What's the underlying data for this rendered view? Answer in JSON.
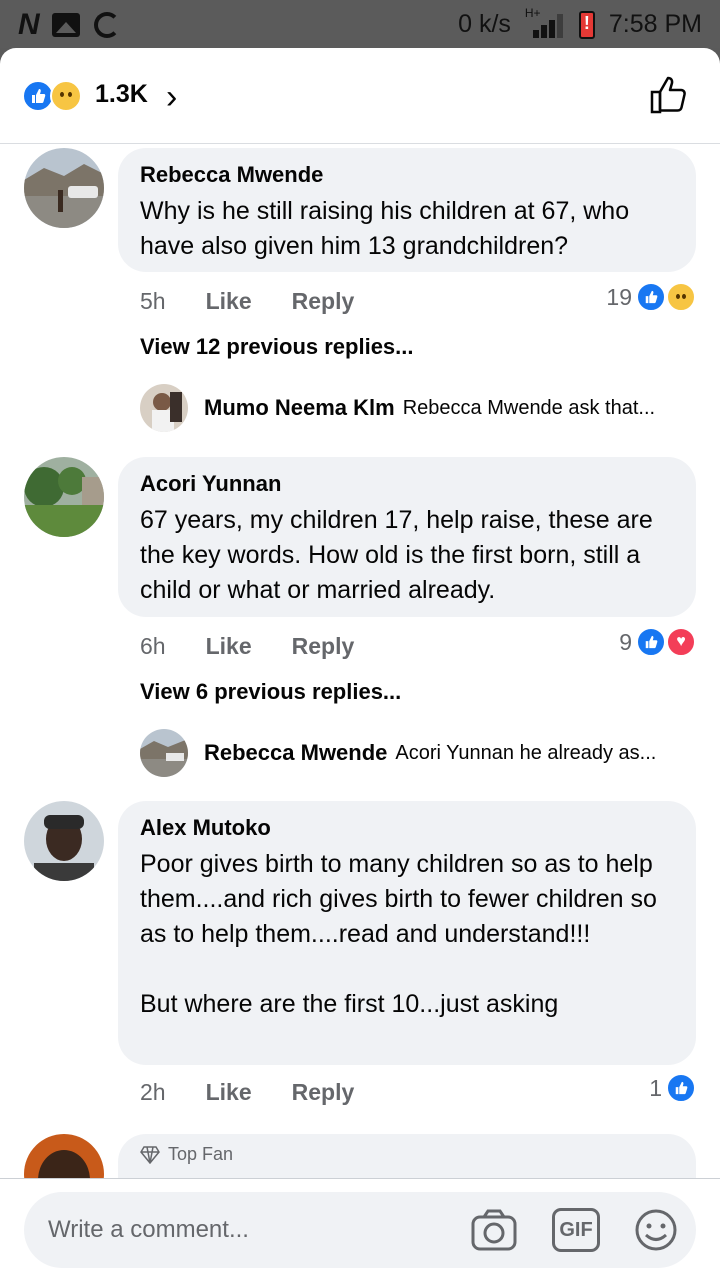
{
  "status_bar": {
    "net_speed": "0 k/s",
    "network": "H+",
    "time": "7:58 PM"
  },
  "header": {
    "reaction_count": "1.3K",
    "reactions": [
      "like-icon",
      "sad-icon"
    ]
  },
  "comments": [
    {
      "author": "Rebecca Mwende",
      "text": "Why is he still raising his children at 67, who have also given him 13 grandchildren?",
      "time": "5h",
      "like_label": "Like",
      "reply_label": "Reply",
      "reaction_count": "19",
      "view_previous": "View 12 previous replies...",
      "latest_reply": {
        "author": "Mumo Neema Klm",
        "text": "Rebecca Mwende ask that..."
      }
    },
    {
      "author": "Acori Yunnan",
      "text": "67 years, my children 17, help raise, these are the key words. How old is the first born, still a child or what or married already.",
      "time": "6h",
      "like_label": "Like",
      "reply_label": "Reply",
      "reaction_count": "9",
      "view_previous": "View 6 previous replies...",
      "latest_reply": {
        "author": "Rebecca Mwende",
        "text": "Acori Yunnan he already as..."
      }
    },
    {
      "author": "Alex Mutoko",
      "text": "Poor gives birth to many children so as to help them....and rich gives birth to fewer children so as to help them....read and understand!!!\n\nBut where are the first 10...just asking",
      "time": "2h",
      "like_label": "Like",
      "reply_label": "Reply",
      "reaction_count": "1"
    }
  ],
  "partial_comment": {
    "badge": "Top Fan"
  },
  "composer": {
    "placeholder": "Write a comment...",
    "gif_label": "GIF"
  },
  "colors": {
    "accent": "#1877f2",
    "bubble": "#f0f2f5",
    "secondary_text": "#65676b"
  }
}
